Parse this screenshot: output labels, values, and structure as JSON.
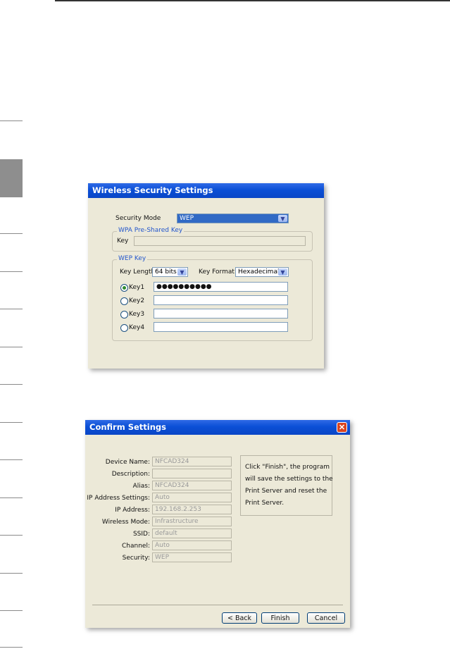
{
  "wifi_dialog": {
    "title": "Wireless Security Settings",
    "security_mode_label": "Security Mode",
    "security_mode_value": "WEP",
    "wpa_group": "WPA Pre-Shared Key",
    "wpa_key_label": "Key",
    "wep_group": "WEP Key",
    "key_length_label": "Key Length",
    "key_length_value": "64 bits",
    "key_format_label": "Key Format",
    "key_format_value": "Hexadecimal",
    "keys": [
      {
        "label": "Key1",
        "value": "●●●●●●●●●●",
        "selected": true
      },
      {
        "label": "Key2",
        "value": "",
        "selected": false
      },
      {
        "label": "Key3",
        "value": "",
        "selected": false
      },
      {
        "label": "Key4",
        "value": "",
        "selected": false
      }
    ]
  },
  "confirm_dialog": {
    "title": "Confirm Settings",
    "close_icon": "close-icon",
    "fields": [
      {
        "label": "Device Name:",
        "value": "NFCAD324"
      },
      {
        "label": "Description:",
        "value": ""
      },
      {
        "label": "Alias:",
        "value": "NFCAD324"
      },
      {
        "label": "IP Address Settings:",
        "value": "Auto"
      },
      {
        "label": "IP Address:",
        "value": "192.168.2.253"
      },
      {
        "label": "Wireless Mode:",
        "value": "Infrastructure"
      },
      {
        "label": "SSID:",
        "value": "default"
      },
      {
        "label": "Channel:",
        "value": "Auto"
      },
      {
        "label": "Security:",
        "value": "WEP"
      }
    ],
    "info_lines": [
      "Click \"Finish\", the program",
      "will save the settings to the",
      "Print Server and reset the",
      "Print Server."
    ],
    "back_label": "< Back",
    "finish_label": "Finish",
    "cancel_label": "Cancel"
  },
  "colors": {
    "title_bar": "#0a46c6",
    "dialog_bg": "#ece9d8",
    "side_tab": "#8e8e8e"
  }
}
